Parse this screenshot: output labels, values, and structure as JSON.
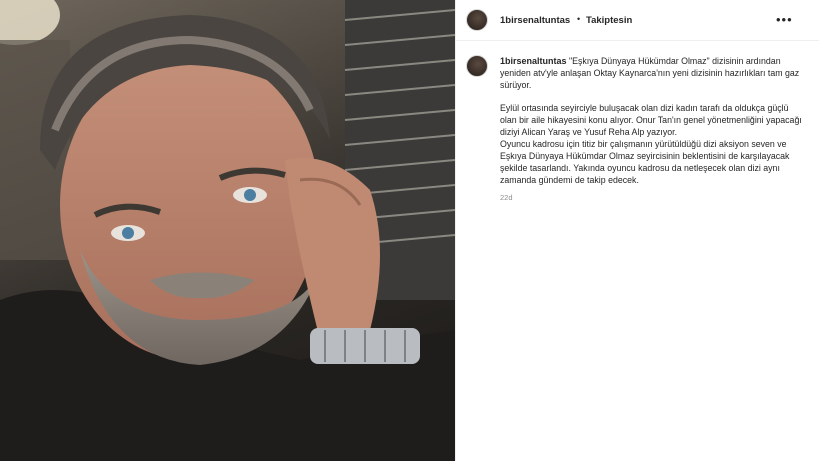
{
  "post": {
    "username": "1birsenaltuntas",
    "follow_status": "Takiptesin",
    "dot": "•",
    "more_label": "•••",
    "caption_username": "1birsenaltuntas",
    "paragraph1": "\"Eşkıya Dünyaya Hükümdar Olmaz\" dizisinin ardından yeniden atv'yle anlaşan Oktay Kaynarca'nın yeni dizisinin hazırlıkları tam gaz sürüyor.",
    "paragraph2": "Eylül ortasında seyirciyle buluşacak olan dizi kadın tarafı da oldukça güçlü olan bir aile hikayesini konu alıyor. Onur Tan'ın genel yönetmenliğini yapacağı diziyi Alican Yaraş ve Yusuf Reha Alp yazıyor.",
    "paragraph3": "Oyuncu kadrosu için titiz bir çalışmanın yürütüldüğü dizi aksiyon seven ve Eşkıya Dünyaya Hükümdar Olmaz seyircisinin beklentisini de karşılayacak şekilde tasarlandı. Yakında oyuncu kadrosu da netleşecek olan dizi aynı zamanda gündemi de takip edecek.",
    "timestamp": "22d"
  },
  "icons": {
    "more": "more-horizontal-icon"
  }
}
